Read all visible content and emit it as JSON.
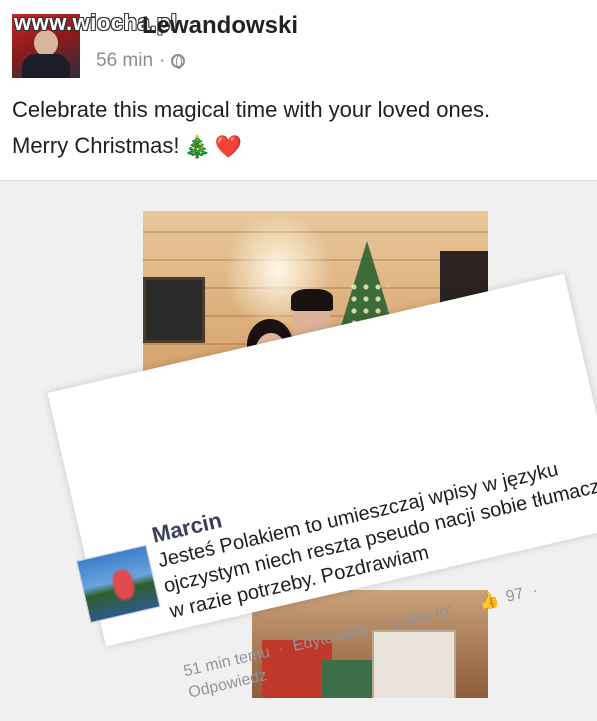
{
  "post": {
    "author_name": "Lewandowski",
    "watermark": "www.wiocha.pl",
    "time": "56 min",
    "separator": "·",
    "audience_icon": "globe-icon",
    "text_line1": "Celebrate this magical time with your loved ones.",
    "text_line2": "Merry Christmas!",
    "emoji_tree": "🎄",
    "emoji_heart": "❤️"
  },
  "comment": {
    "name": "Marcin",
    "text": "Jesteś Polakiem to umieszczaj wpisy w języku ojczystym niech reszta pseudo nacji sobie tłumaczy w razie potrzeby. Pozdrawiam",
    "time": "51 min temu",
    "edited": "Edytowany",
    "like_label": "Lubię to!",
    "like_count": "97",
    "reply_label": "Odpowiedz",
    "separator": "·"
  },
  "colors": {
    "post_text": "#1c1e21",
    "meta_gray": "#90949c",
    "like_blue": "#5b7bd5"
  }
}
